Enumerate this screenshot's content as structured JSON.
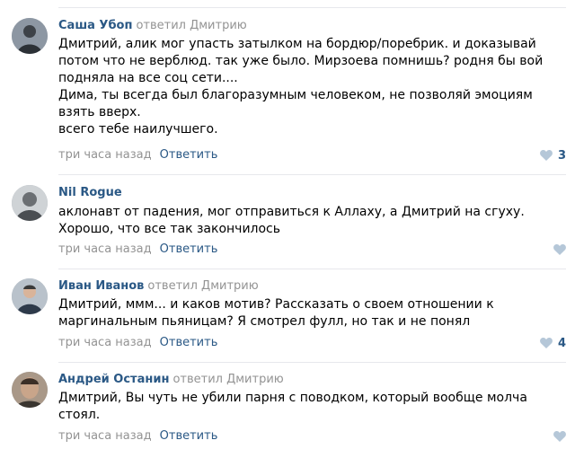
{
  "comments": [
    {
      "author": "Саша Убоп",
      "reply_to": "ответил Дмитрию",
      "lines": [
        "Дмитрий, алик мог упасть затылком на бордюр/поребрик. и доказывай",
        "потом что не верблюд. так уже было. Мирзоева помнишь? родня бы вой",
        "подняла на все соц сети....",
        "Дима, ты всегда был благоразумным человеком, не позволяй эмоциям",
        "взять вверх.",
        "всего тебе наилучшего."
      ],
      "time": "три часа назад",
      "reply_label": "Ответить",
      "likes": "3"
    },
    {
      "author": "Nil Rogue",
      "reply_to": "",
      "lines": [
        "аклонавт от падения, мог отправиться к Аллаху, а Дмитрий на сгуху.",
        "Хорошо, что все так закончилось"
      ],
      "time": "три часа назад",
      "reply_label": "Ответить",
      "likes": ""
    },
    {
      "author": "Иван Иванов",
      "reply_to": "ответил Дмитрию",
      "lines": [
        "Дмитрий, ммм... и каков мотив? Рассказать о своем отношении к",
        "маргинальным пьяницам? Я смотрел фулл, но так и не понял"
      ],
      "time": "три часа назад",
      "reply_label": "Ответить",
      "likes": "4"
    },
    {
      "author": "Андрей Останин",
      "reply_to": "ответил Дмитрию",
      "lines": [
        "Дмитрий, Вы чуть не убили парня с поводком, который вообще молча",
        "стоял."
      ],
      "time": "три часа назад",
      "reply_label": "Ответить",
      "likes": ""
    }
  ],
  "colors": {
    "link": "#2a5885",
    "muted": "#939393",
    "like_icon": "#b5c7d8",
    "divider": "#e7e8ec"
  }
}
